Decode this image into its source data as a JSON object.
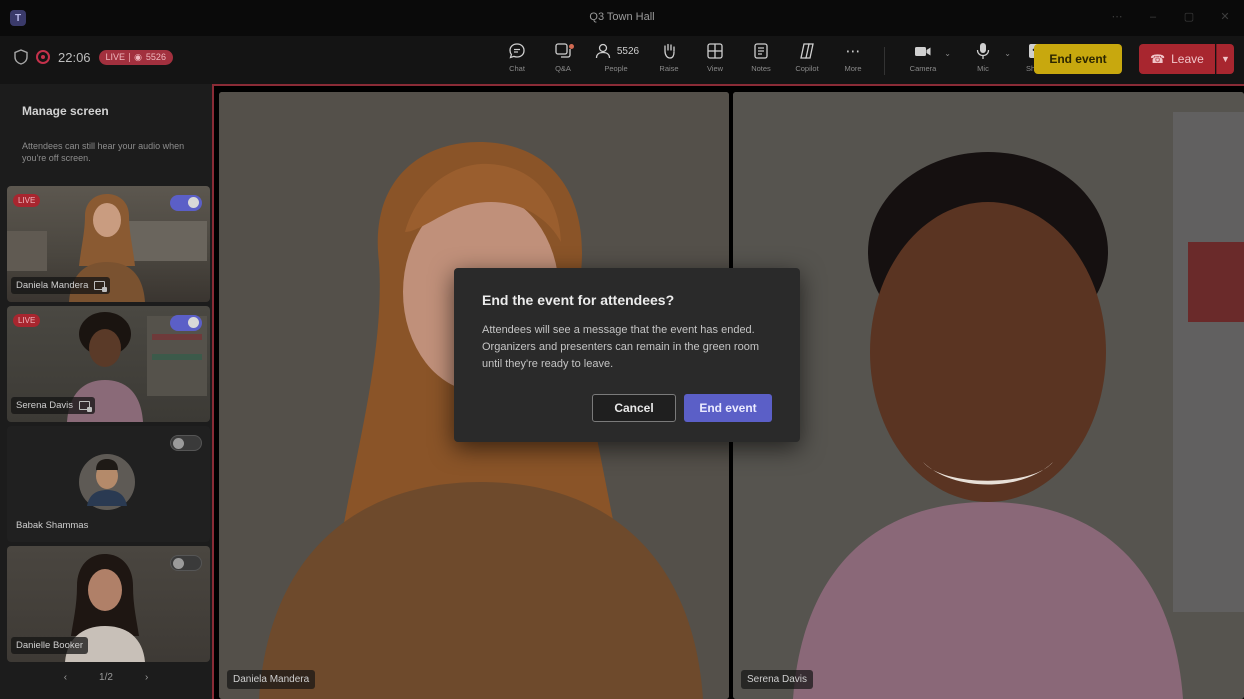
{
  "window": {
    "title": "Q3 Town Hall"
  },
  "status": {
    "timer": "22:06",
    "live_label": "LIVE",
    "viewer_count": "5526"
  },
  "toolbar": {
    "buttons": [
      {
        "icon": "chat-icon",
        "label": "Chat"
      },
      {
        "icon": "qa-icon",
        "label": "Q&A"
      },
      {
        "icon": "people-icon",
        "label": "People",
        "count": "5526"
      },
      {
        "icon": "raise-hand-icon",
        "label": "Raise"
      },
      {
        "icon": "view-icon",
        "label": "View"
      },
      {
        "icon": "notes-icon",
        "label": "Notes"
      },
      {
        "icon": "copilot-icon",
        "label": "Copilot"
      },
      {
        "icon": "more-icon",
        "label": "More"
      }
    ],
    "camera_label": "Camera",
    "mic_label": "Mic",
    "share_label": "Share",
    "end_event_label": "End event",
    "leave_label": "Leave"
  },
  "sidebar": {
    "title": "Manage screen",
    "description": "Attendees can still hear your audio when you're off screen.",
    "tiles": [
      {
        "name": "Daniela Mandera",
        "live": "LIVE",
        "on_screen": true
      },
      {
        "name": "Serena Davis",
        "live": "LIVE",
        "on_screen": true
      },
      {
        "name": "Babak Shammas",
        "on_screen": false
      },
      {
        "name": "Danielle Booker",
        "on_screen": false
      }
    ],
    "pager": {
      "current": "1/2"
    }
  },
  "stage": {
    "left_name": "Daniela Mandera",
    "right_name": "Serena Davis"
  },
  "dialog": {
    "title": "End the event for attendees?",
    "body": "Attendees will see a message that the event has ended. Organizers and presenters can remain in the green room until they're ready to leave.",
    "cancel_label": "Cancel",
    "confirm_label": "End event"
  },
  "colors": {
    "accent": "#5b5fc7",
    "end_event": "#c8a80e",
    "leave": "#a8262f",
    "live": "#a8262f"
  }
}
